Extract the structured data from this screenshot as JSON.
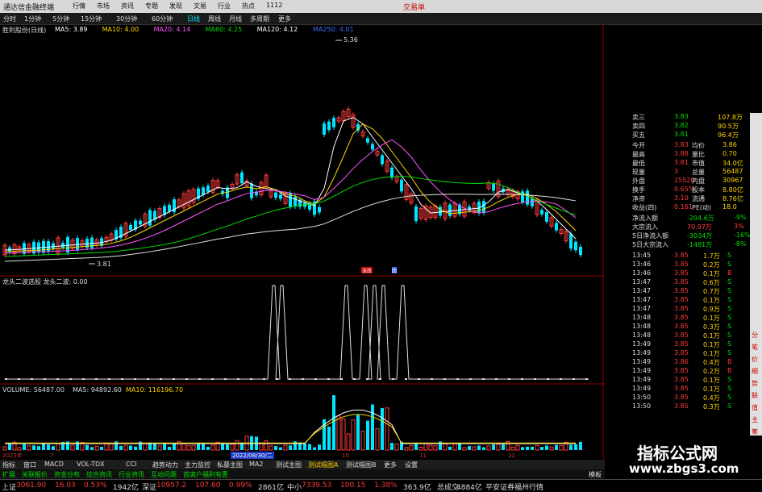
{
  "app": {
    "title": "通达信金融终端",
    "menu_win": "交易单"
  },
  "menu": [
    "行情",
    "市场",
    "资讯",
    "专题",
    "发现",
    "文易",
    "行业",
    "热点",
    "1112"
  ],
  "toolbar": {
    "items": [
      "分时",
      "1分钟",
      "5分钟",
      "15分钟",
      "30分钟",
      "60分钟",
      "日线",
      "周线",
      "月线",
      "多周期",
      "更多"
    ],
    "active": "日线"
  },
  "stock_name": "胜利股份(日线)",
  "ma_legend": [
    {
      "text": "MA5: 3.89",
      "color": "#ffffff"
    },
    {
      "text": "MA10: 4.00",
      "color": "#ffd400"
    },
    {
      "text": "MA20: 4.14",
      "color": "#ff55ff"
    },
    {
      "text": "MA60: 4.25",
      "color": "#00dd00"
    },
    {
      "text": "MA120: 4.12",
      "color": "#ffffff"
    },
    {
      "text": "MA250: 4.01",
      "color": "#3f6bff"
    }
  ],
  "high_label": "5.36",
  "low_label": "3.81",
  "price_axis": [
    "4.70",
    "4.60",
    "4.50",
    "4.40",
    "4.30",
    "4.20",
    "4.10",
    "4.00",
    "3.90",
    "3.80",
    "3.70"
  ],
  "marker_a": "涨跌",
  "marker_b": "回",
  "indicator": {
    "title": "龙头二波选股  龙头二波: 0.00",
    "axis": [
      "1.00",
      "0.80",
      "0.60",
      "0.40",
      "0.20"
    ],
    "current": "0.84"
  },
  "volume": {
    "title": "VOLUME: 56487.00",
    "ma5": "MA5: 94892.60",
    "ma10": "MA10: 116196.70",
    "axis": [
      "20000",
      "10000"
    ]
  },
  "date_axis": {
    "year": "2022年",
    "m7": "7",
    "sel_date": "2022/08/30/二",
    "m10": "10",
    "m11": "11",
    "m12": "12"
  },
  "quote_top": [
    {
      "label": "卖三",
      "price": "3.83",
      "vol": "107.8万"
    },
    {
      "label": "卖四",
      "price": "3.82",
      "vol": "90.5万"
    },
    {
      "label": "买五",
      "price": "3.81",
      "vol": "96.4万"
    }
  ],
  "quote_stats": [
    {
      "l1": "今开",
      "v1": "3.83",
      "l2": "均价",
      "v2": "3.86"
    },
    {
      "l1": "最高",
      "v1": "3.88",
      "l2": "量比",
      "v2": "0.70"
    },
    {
      "l1": "最低",
      "v1": "3.81",
      "l2": "市值",
      "v2": "34.0亿"
    },
    {
      "l1": "现量",
      "v1": "3",
      "l2": "总量",
      "v2": "56487"
    },
    {
      "l1": "外盘",
      "v1": "25520",
      "l2": "内盘",
      "v2": "30967"
    },
    {
      "l1": "换手",
      "v1": "0.65%",
      "l2": "股本",
      "v2": "8.80亿"
    },
    {
      "l1": "净资",
      "v1": "3.10",
      "l2": "流通",
      "v2": "8.76亿"
    },
    {
      "l1": "收益(四)",
      "v1": "0.161",
      "l2": "PE(动)",
      "v2": "18.0"
    }
  ],
  "flows": [
    {
      "label": "净流入额",
      "value": "-204.6万",
      "pct": "-9%"
    },
    {
      "label": "大宗流入",
      "value": "70.97万",
      "pct": "3%"
    },
    {
      "label": "5日净流入额",
      "value": "-3034万",
      "pct": "-16%"
    },
    {
      "label": "5日大宗流入",
      "value": "-1481万",
      "pct": "-8%"
    }
  ],
  "ticks": [
    {
      "t": "13:45",
      "p": "3.85",
      "v": "1.7万",
      "s": "S"
    },
    {
      "t": "13:46",
      "p": "3.85",
      "v": "0.2万",
      "s": "S"
    },
    {
      "t": "13:46",
      "p": "3.85",
      "v": "0.1万",
      "s": "B"
    },
    {
      "t": "13:47",
      "p": "3.85",
      "v": "0.6万",
      "s": "S"
    },
    {
      "t": "13:47",
      "p": "3.85",
      "v": "0.7万",
      "s": "S"
    },
    {
      "t": "13:47",
      "p": "3.85",
      "v": "0.1万",
      "s": "S"
    },
    {
      "t": "13:47",
      "p": "3.85",
      "v": "0.9万",
      "s": "S"
    },
    {
      "t": "13:48",
      "p": "3.85",
      "v": "0.1万",
      "s": "S"
    },
    {
      "t": "13:48",
      "p": "3.85",
      "v": "0.3万",
      "s": "S"
    },
    {
      "t": "13:48",
      "p": "3.85",
      "v": "0.1万",
      "s": "S"
    },
    {
      "t": "13:49",
      "p": "3.85",
      "v": "0.1万",
      "s": "S"
    },
    {
      "t": "13:49",
      "p": "3.85",
      "v": "0.1万",
      "s": "S"
    },
    {
      "t": "13:49",
      "p": "3.86",
      "v": "0.4万",
      "s": "B"
    },
    {
      "t": "13:49",
      "p": "3.85",
      "v": "0.2万",
      "s": "B"
    },
    {
      "t": "13:49",
      "p": "3.85",
      "v": "0.1万",
      "s": "S"
    },
    {
      "t": "13:49",
      "p": "3.85",
      "v": "0.1万",
      "s": "S"
    },
    {
      "t": "13:50",
      "p": "3.85",
      "v": "0.4万",
      "s": "S"
    },
    {
      "t": "13:50",
      "p": "3.85",
      "v": "0.3万",
      "s": "S"
    }
  ],
  "sidebar": [
    "分",
    "笔",
    "价",
    "细",
    "势",
    "联",
    "值",
    "主",
    "筹"
  ],
  "bottom_tabs": {
    "items": [
      "指标",
      "窗口",
      "MACD",
      "VOL-TDX",
      "CCI",
      "趋势动力",
      "主力监控",
      "私募主图",
      "MA2",
      "测试主图",
      "测试幅图A",
      "测试幅图B",
      "更多",
      "设置"
    ],
    "active": "测试幅图A"
  },
  "bottom_tabs2": {
    "items": [
      "扩展",
      "关联报价",
      "资金分布",
      "综合资讯",
      "行业资讯",
      "互动问题",
      "首席户福利有惠"
    ],
    "right": "模板"
  },
  "status": [
    {
      "text": "上证",
      "color": "#ddd"
    },
    {
      "text": "3061.90",
      "color": "#ff3b3b"
    },
    {
      "text": "16.03",
      "color": "#ff3b3b"
    },
    {
      "text": "0.53%",
      "color": "#ff3b3b"
    },
    {
      "text": "1942亿",
      "color": "#ddd"
    },
    {
      "text": "深证",
      "color": "#ddd"
    },
    {
      "text": "10957.2",
      "color": "#ff3b3b"
    },
    {
      "text": "107.60",
      "color": "#ff3b3b"
    },
    {
      "text": "0.99%",
      "color": "#ff3b3b"
    },
    {
      "text": "2861亿",
      "color": "#ddd"
    },
    {
      "text": "中小",
      "color": "#ddd"
    },
    {
      "text": "7339.53",
      "color": "#ff3b3b"
    },
    {
      "text": "100.15",
      "color": "#ff3b3b"
    },
    {
      "text": "1.38%",
      "color": "#ff3b3b"
    },
    {
      "text": "363.9亿",
      "color": "#ddd"
    },
    {
      "text": "总成交",
      "color": "#ddd"
    },
    {
      "text": "4884亿",
      "color": "#ddd"
    },
    {
      "text": "平安证券福州行情",
      "color": "#ddd"
    }
  ],
  "watermark": {
    "title": "指标公式网",
    "url": "www.zbgs3.com"
  },
  "colors": {
    "up": "#ff3b3b",
    "down": "#00e5ff",
    "ma5": "#ffffff",
    "ma10": "#ffd400",
    "ma20": "#ff55ff",
    "ma60": "#00dd00",
    "ma120": "#e0e0e0",
    "ma250": "#3f6bff"
  }
}
